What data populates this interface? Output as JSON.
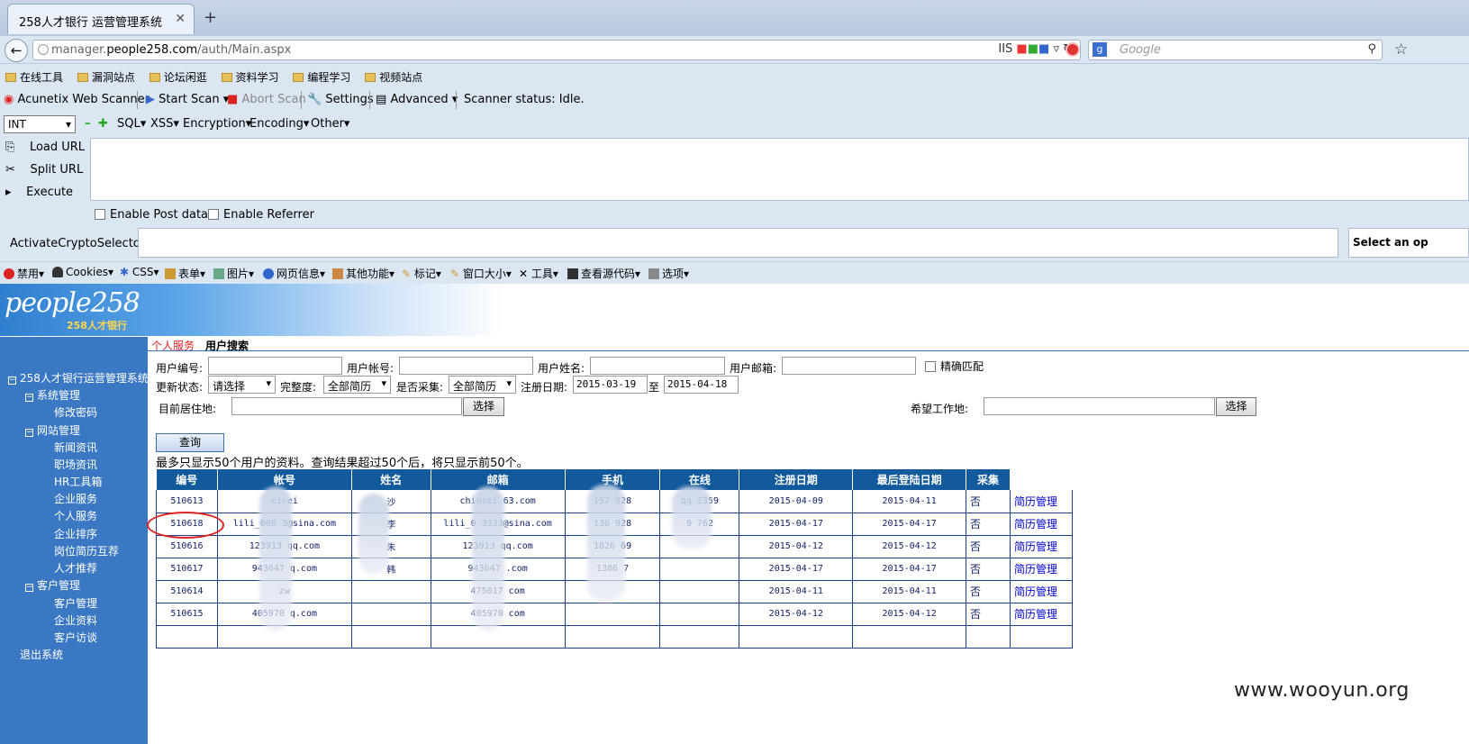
{
  "browser": {
    "tab_title": "258人才银行 运营管理系统",
    "url_prefix": "manager.",
    "url_domain": "people258.com",
    "url_path": "/auth/Main.aspx",
    "url_right": "IIS",
    "search_placeholder": "Google"
  },
  "bookmarks": [
    "在线工具",
    "漏洞站点",
    "论坛闲逛",
    "资料学习",
    "编程学习",
    "视频站点"
  ],
  "acunetix": {
    "title": "Acunetix Web Scanner",
    "start_scan": "Start Scan",
    "abort_scan": "Abort Scan",
    "settings": "Settings",
    "advanced": "Advanced",
    "status": "Scanner status: Idle."
  },
  "hackbar": {
    "select_value": "INT",
    "menus": [
      "SQL",
      "XSS",
      "Encryption",
      "Encoding",
      "Other"
    ],
    "load_url": "Load URL",
    "split_url": "Split URL",
    "execute": "Execute",
    "enable_post": "Enable Post data",
    "enable_referrer": "Enable Referrer",
    "crypto_label": "ActivateCryptoSelector",
    "select_op": "Select an op"
  },
  "webdev": [
    "禁用",
    "Cookies",
    "CSS",
    "表单",
    "图片",
    "网页信息",
    "其他功能",
    "标记",
    "窗口大小",
    "工具",
    "查看源代码",
    "选项"
  ],
  "site": {
    "logo": "people258",
    "logo_sub": "258人才银行"
  },
  "sidebar": {
    "root": "258人才银行运营管理系统",
    "groups": [
      {
        "label": "系统管理",
        "items": [
          "修改密码"
        ]
      },
      {
        "label": "网站管理",
        "items": [
          "新闻资讯",
          "职场资讯",
          "HR工具箱",
          "企业服务",
          "个人服务",
          "企业排序",
          "岗位简历互荐",
          "人才推荐"
        ]
      },
      {
        "label": "客户管理",
        "items": [
          "客户管理",
          "企业资料",
          "客户访谈"
        ]
      }
    ],
    "logout": "退出系统"
  },
  "tabs": {
    "parent": "个人服务",
    "current": "用户搜索"
  },
  "form": {
    "user_id": "用户编号:",
    "user_account": "用户帐号:",
    "user_name": "用户姓名:",
    "user_email": "用户邮箱:",
    "exact_match": "精确匹配",
    "update_status": "更新状态:",
    "update_status_value": "请选择",
    "completeness": "完整度:",
    "completeness_value": "全部简历",
    "collected": "是否采集:",
    "collected_value": "全部简历",
    "reg_date": "注册日期:",
    "date_from": "2015-03-19",
    "date_to_label": "至",
    "date_to": "2015-04-18",
    "current_location": "目前居住地:",
    "choose": "选择",
    "desired_location": "希望工作地:",
    "query": "查询",
    "notice": "最多只显示50个用户的资料。查询结果超过50个后，将只显示前50个。"
  },
  "table": {
    "headers": [
      "编号",
      "帐号",
      "姓名",
      "邮箱",
      "手机",
      "在线",
      "注册日期",
      "最后登陆日期",
      "采集",
      ""
    ],
    "rows": [
      [
        "510613",
        "eirei",
        "沙",
        "chinrei 63.com",
        "157 928",
        "qq 2359",
        "2015-04-09",
        "2015-04-11",
        "否",
        "简历管理"
      ],
      [
        "510618",
        "lili_008 3@sina.com",
        "李",
        "lili_0 3333@sina.com",
        "136 928",
        "9 762",
        "2015-04-17",
        "2015-04-17",
        "否",
        "简历管理"
      ],
      [
        "510616",
        "123913 qq.com",
        "朱",
        "123913 qq.com",
        "1826 69",
        "",
        "2015-04-12",
        "2015-04-12",
        "否",
        "简历管理"
      ],
      [
        "510617",
        "943647 q.com",
        "韩",
        "943647 .com",
        "1386 7",
        "",
        "2015-04-17",
        "2015-04-17",
        "否",
        "简历管理"
      ],
      [
        "510614",
        "zw",
        "",
        "475017 com",
        "",
        "",
        "2015-04-11",
        "2015-04-11",
        "否",
        "简历管理"
      ],
      [
        "510615",
        "405970 q.com",
        "",
        "405970 com",
        "",
        "",
        "2015-04-12",
        "2015-04-12",
        "否",
        "简历管理"
      ],
      [
        "",
        "",
        "",
        "",
        "",
        "",
        "",
        "",
        "",
        ""
      ]
    ]
  },
  "watermark": "www.wooyun.org"
}
